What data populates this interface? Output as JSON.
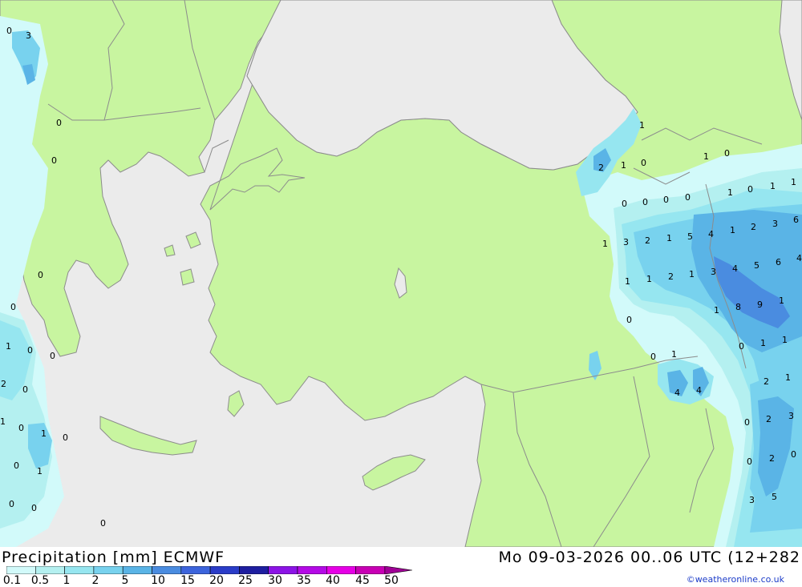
{
  "footer": {
    "title": "Precipitation [mm] ECMWF",
    "datetime": "Mo 09-03-2026 00..06 UTC (12+282",
    "credit": "©weatheronline.co.uk"
  },
  "legend": {
    "ticks": [
      "0.1",
      "0.5",
      "1",
      "2",
      "5",
      "10",
      "15",
      "20",
      "25",
      "30",
      "35",
      "40",
      "45",
      "50"
    ],
    "colors": [
      "#d2fafa",
      "#b4f0f0",
      "#96e6f0",
      "#78d2ee",
      "#5ab4e6",
      "#4a8ce0",
      "#3c64dc",
      "#2a3cc8",
      "#1e1ea0",
      "#8c14e6",
      "#b40ae6",
      "#e600e6",
      "#c800b4",
      "#a00096"
    ]
  },
  "map": {
    "land_color": "#c8f5a0",
    "sea_color": "#ebebeb",
    "border_color": "#8c8c8c",
    "labels": [
      {
        "t": "0"
      },
      {
        "t": "3"
      },
      {
        "t": "0"
      },
      {
        "t": "0"
      },
      {
        "t": "0"
      },
      {
        "t": "0"
      },
      {
        "t": "1"
      },
      {
        "t": "0"
      },
      {
        "t": "0"
      },
      {
        "t": "2"
      },
      {
        "t": "0"
      },
      {
        "t": "1"
      },
      {
        "t": "0"
      },
      {
        "t": "1"
      },
      {
        "t": "0"
      },
      {
        "t": "1"
      },
      {
        "t": "0"
      },
      {
        "t": "0"
      },
      {
        "t": "0"
      },
      {
        "t": "0"
      },
      {
        "t": "1"
      },
      {
        "t": "2"
      },
      {
        "t": "1"
      },
      {
        "t": "0"
      },
      {
        "t": "1"
      },
      {
        "t": "0"
      },
      {
        "t": "1"
      },
      {
        "t": "0"
      },
      {
        "t": "1"
      },
      {
        "t": "1"
      },
      {
        "t": "0"
      },
      {
        "t": "0"
      },
      {
        "t": "0"
      },
      {
        "t": "0"
      },
      {
        "t": "1"
      },
      {
        "t": "3"
      },
      {
        "t": "2"
      },
      {
        "t": "1"
      },
      {
        "t": "5"
      },
      {
        "t": "4"
      },
      {
        "t": "1"
      },
      {
        "t": "2"
      },
      {
        "t": "3"
      },
      {
        "t": "6"
      },
      {
        "t": "1"
      },
      {
        "t": "1"
      },
      {
        "t": "2"
      },
      {
        "t": "1"
      },
      {
        "t": "3"
      },
      {
        "t": "4"
      },
      {
        "t": "5"
      },
      {
        "t": "6"
      },
      {
        "t": "4"
      },
      {
        "t": "1"
      },
      {
        "t": "8"
      },
      {
        "t": "9"
      },
      {
        "t": "1"
      },
      {
        "t": "0"
      },
      {
        "t": "0"
      },
      {
        "t": "1"
      },
      {
        "t": "0"
      },
      {
        "t": "1"
      },
      {
        "t": "1"
      },
      {
        "t": "4"
      },
      {
        "t": "4"
      },
      {
        "t": "2"
      },
      {
        "t": "1"
      },
      {
        "t": "0"
      },
      {
        "t": "2"
      },
      {
        "t": "3"
      },
      {
        "t": "0"
      },
      {
        "t": "2"
      },
      {
        "t": "0"
      },
      {
        "t": "3"
      },
      {
        "t": "5"
      }
    ]
  }
}
